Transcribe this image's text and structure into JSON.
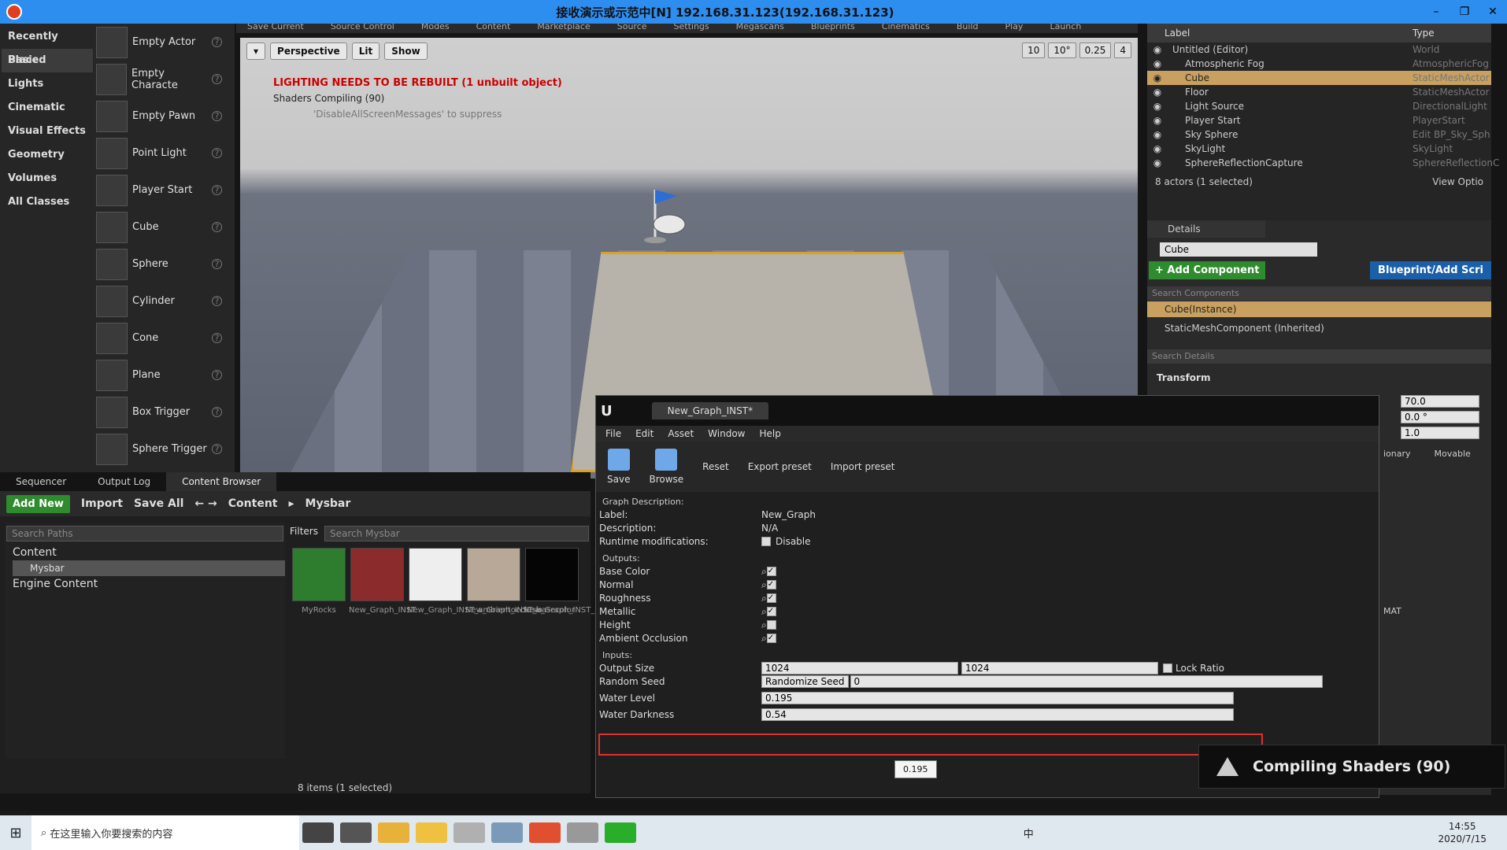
{
  "window": {
    "title": "接收演示或示范中[N] 192.168.31.123(192.168.31.123)",
    "min": "–",
    "max": "❐",
    "close": "✕"
  },
  "menustrip": [
    "Save Current",
    "Source Control",
    "Modes",
    "Content",
    "Marketplace",
    "Source",
    "Settings",
    "Megascans",
    "Blueprints",
    "Cinematics",
    "Build",
    "Play",
    "Launch"
  ],
  "modes": {
    "categories": [
      "Recently Placed",
      "Basic",
      "Lights",
      "Cinematic",
      "Visual Effects",
      "Geometry",
      "Volumes",
      "All Classes"
    ],
    "items": [
      "Empty Actor",
      "Empty Characte",
      "Empty Pawn",
      "Point Light",
      "Player Start",
      "Cube",
      "Sphere",
      "Cylinder",
      "Cone",
      "Plane",
      "Box Trigger",
      "Sphere Trigger"
    ]
  },
  "viewport": {
    "perspective": "Perspective",
    "lit": "Lit",
    "show": "Show",
    "grid": "10",
    "angle": "10°",
    "scale": "0.25",
    "cam": "4",
    "warning": "LIGHTING NEEDS TO BE REBUILT (1 unbuilt object)",
    "compiling": "Shaders Compiling (90)",
    "suppress": "'DisableAllScreenMessages' to suppress"
  },
  "bottom_tabs": [
    "Sequencer",
    "Output Log",
    "Content Browser"
  ],
  "content": {
    "add_new": "Add New",
    "import": "Import",
    "save_all": "Save All",
    "crumb1": "Content",
    "crumb2": "Mysbar",
    "search_paths": "Search Paths",
    "filters": "Filters",
    "search_assets": "Search Mysbar",
    "tree": [
      "Content",
      "Mysbar",
      "Engine Content"
    ],
    "assets": [
      "MyRocks",
      "New_Graph_INST",
      "New_Graph_INST_ambientocclusio",
      "New_Graph_INST_basecolor",
      "New_Graph_INST_metallic"
    ],
    "count": "8 items (1 selected)"
  },
  "outliner": {
    "col_label": "Label",
    "col_type": "Type",
    "rows": [
      [
        "Untitled (Editor)",
        "World"
      ],
      [
        "Atmospheric Fog",
        "AtmosphericFog"
      ],
      [
        "Cube",
        "StaticMeshActor"
      ],
      [
        "Floor",
        "StaticMeshActor"
      ],
      [
        "Light Source",
        "DirectionalLight"
      ],
      [
        "Player Start",
        "PlayerStart"
      ],
      [
        "Sky Sphere",
        "Edit BP_Sky_Sph"
      ],
      [
        "SkyLight",
        "SkyLight"
      ],
      [
        "SphereReflectionCapture",
        "SphereReflectionC"
      ]
    ],
    "count": "8 actors (1 selected)",
    "view_options": "View Optio"
  },
  "details": {
    "tab": "Details",
    "name": "Cube",
    "add_component": "+ Add Component",
    "blueprint": "Blueprint/Add Scri",
    "search_components": "Search Components",
    "instance": "Cube(Instance)",
    "smc": "StaticMeshComponent (Inherited)",
    "search_details": "Search Details",
    "transform": "Transform",
    "z_values": [
      "70.0",
      "0.0 °",
      "1.0"
    ],
    "mobility": [
      "ionary",
      "Movable"
    ],
    "mat": "MAT"
  },
  "sd": {
    "tab": "New_Graph_INST*",
    "menu": [
      "File",
      "Edit",
      "Asset",
      "Window",
      "Help"
    ],
    "save": "Save",
    "browse": "Browse",
    "reset": "Reset",
    "export": "Export preset",
    "import": "Import preset",
    "graph_desc": "Graph Description:",
    "label_k": "Label:",
    "label_v": "New_Graph",
    "desc_k": "Description:",
    "desc_v": "N/A",
    "runtime_k": "Runtime modifications:",
    "runtime_v": "Disable",
    "outputs_h": "Outputs:",
    "outputs": [
      "Base Color",
      "Normal",
      "Roughness",
      "Metallic",
      "Height",
      "Ambient Occlusion"
    ],
    "outputs_checked": [
      true,
      true,
      true,
      true,
      false,
      true
    ],
    "inputs_h": "Inputs:",
    "output_size_k": "Output Size",
    "size_a": "1024",
    "size_b": "1024",
    "lock": "Lock Ratio",
    "seed_k": "Random Seed",
    "randomize": "Randomize Seed",
    "seed_v": "0",
    "water_level_k": "Water Level",
    "water_level_v": "0.195",
    "water_dark_k": "Water Darkness",
    "water_dark_v": "0.54",
    "tooltip": "0.195"
  },
  "toast": "Compiling Shaders (90)",
  "taskbar": {
    "search": "在这里输入你要搜索的内容",
    "time": "14:55",
    "date": "2020/7/15",
    "ime": "中"
  }
}
